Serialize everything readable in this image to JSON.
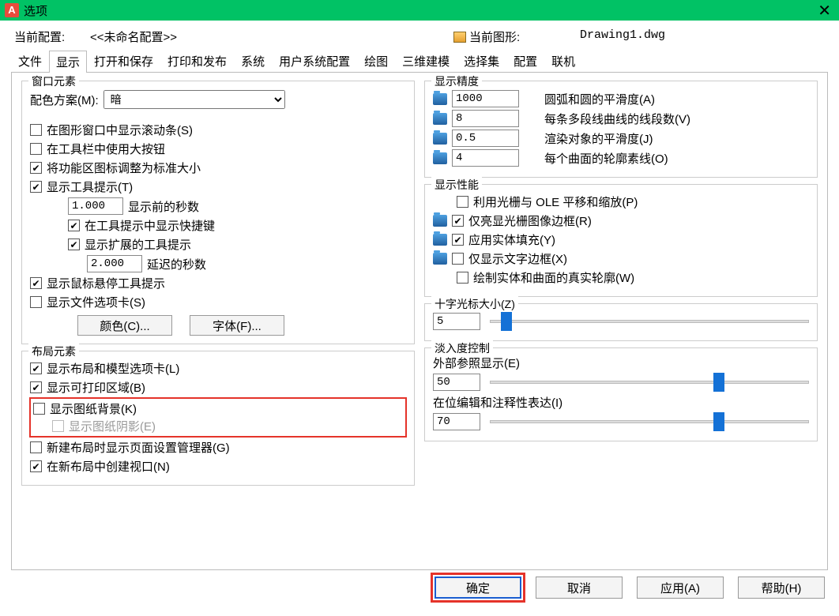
{
  "window": {
    "title": "选项",
    "app_letter": "A"
  },
  "profile": {
    "current_label": "当前配置:",
    "current_value": "<<未命名配置>>",
    "drawing_label": "当前图形:",
    "drawing_value": "Drawing1.dwg"
  },
  "tabs": [
    "文件",
    "显示",
    "打开和保存",
    "打印和发布",
    "系统",
    "用户系统配置",
    "绘图",
    "三维建模",
    "选择集",
    "配置",
    "联机"
  ],
  "active_tab_index": 1,
  "window_elements": {
    "legend": "窗口元素",
    "scheme_label": "配色方案(M):",
    "scheme_value": "暗",
    "cb_scrollbars": "在图形窗口中显示滚动条(S)",
    "cb_bigbuttons": "在工具栏中使用大按钮",
    "cb_ribbon_std": "将功能区图标调整为标准大小",
    "cb_tooltips": "显示工具提示(T)",
    "tooltip_delay_value": "1.000",
    "tooltip_delay_label": "显示前的秒数",
    "cb_tooltip_shortcut": "在工具提示中显示快捷键",
    "cb_tooltip_ext": "显示扩展的工具提示",
    "ext_delay_value": "2.000",
    "ext_delay_label": "延迟的秒数",
    "cb_hover": "显示鼠标悬停工具提示",
    "cb_filetabs": "显示文件选项卡(S)",
    "btn_color": "颜色(C)...",
    "btn_font": "字体(F)..."
  },
  "layout_elements": {
    "legend": "布局元素",
    "cb_tabs": "显示布局和模型选项卡(L)",
    "cb_printable": "显示可打印区域(B)",
    "cb_paperbg": "显示图纸背景(K)",
    "cb_papershadow": "显示图纸阴影(E)",
    "cb_pagemgr": "新建布局时显示页面设置管理器(G)",
    "cb_viewport": "在新布局中创建视口(N)"
  },
  "precision": {
    "legend": "显示精度",
    "arc_value": "1000",
    "arc_label": "圆弧和圆的平滑度(A)",
    "pline_value": "8",
    "pline_label": "每条多段线曲线的线段数(V)",
    "render_value": "0.5",
    "render_label": "渲染对象的平滑度(J)",
    "surf_value": "4",
    "surf_label": "每个曲面的轮廓素线(O)"
  },
  "performance": {
    "legend": "显示性能",
    "cb_panzoom": "利用光栅与 OLE 平移和缩放(P)",
    "cb_highlight": "仅亮显光栅图像边框(R)",
    "cb_solidfill": "应用实体填充(Y)",
    "cb_textframe": "仅显示文字边框(X)",
    "cb_silhouette": "绘制实体和曲面的真实轮廓(W)"
  },
  "crosshair": {
    "legend": "十字光标大小(Z)",
    "value": "5"
  },
  "fade": {
    "legend": "淡入度控制",
    "xref_label": "外部参照显示(E)",
    "xref_value": "50",
    "inplace_label": "在位编辑和注释性表达(I)",
    "inplace_value": "70"
  },
  "footer": {
    "ok": "确定",
    "cancel": "取消",
    "apply": "应用(A)",
    "help": "帮助(H)"
  }
}
